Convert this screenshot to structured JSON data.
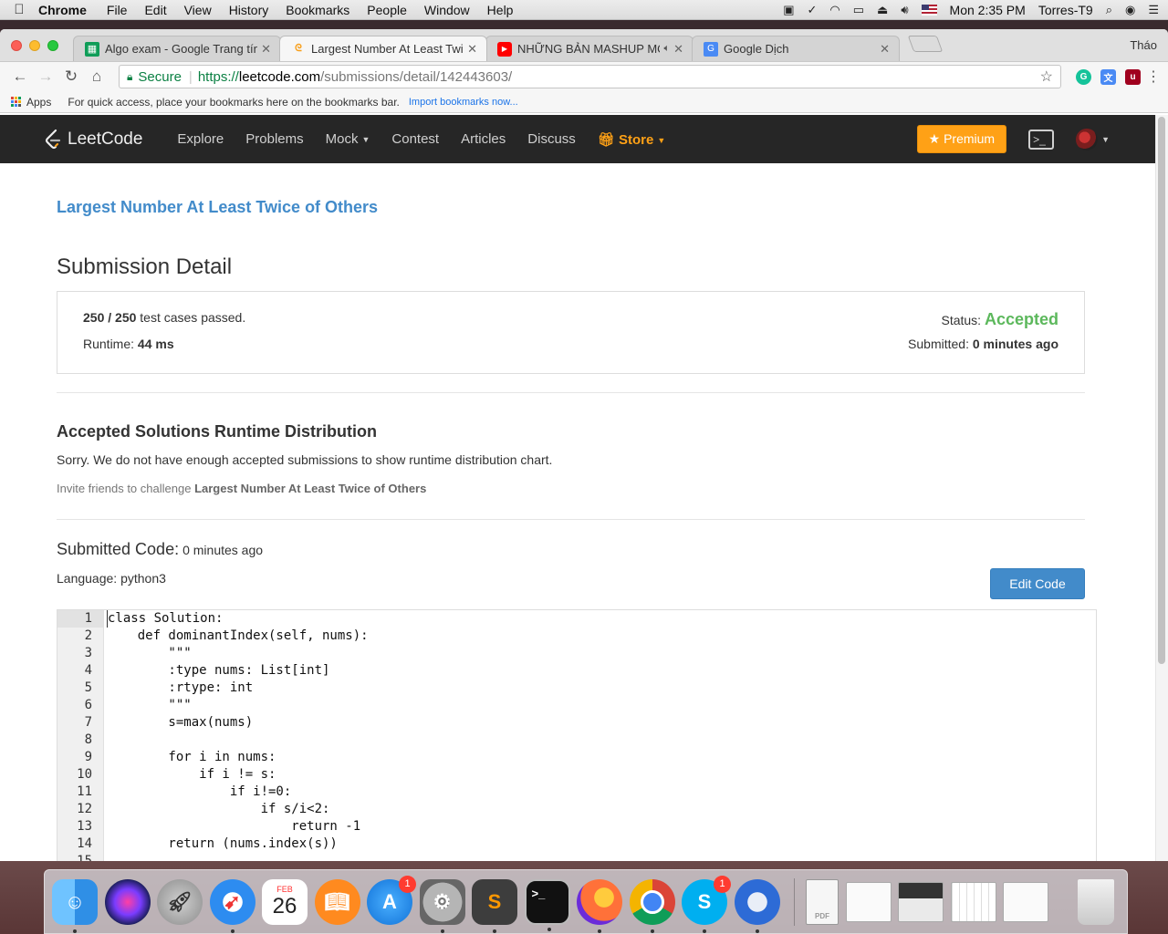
{
  "menubar": {
    "app_name": "Chrome",
    "menus": [
      "File",
      "Edit",
      "View",
      "History",
      "Bookmarks",
      "People",
      "Window",
      "Help"
    ],
    "clock": "Mon 2:35 PM",
    "username": "Torres-T9"
  },
  "browser": {
    "profile_name": "Tháo",
    "tabs": [
      {
        "title": "Algo exam - Google Trang tính",
        "icon": "sheets-icon",
        "active": false
      },
      {
        "title": "Largest Number At Least Twice",
        "icon": "leetcode-icon",
        "active": true
      },
      {
        "title": "NHỮNG BẢN MASHUP MỚI",
        "icon": "youtube-icon",
        "active": false
      },
      {
        "title": "Google Dịch",
        "icon": "google-translate-icon",
        "active": false
      }
    ],
    "omnibox": {
      "secure_label": "Secure",
      "url_scheme": "https://",
      "url_host": "leetcode.com",
      "url_path": "/submissions/detail/142443603/"
    },
    "bookmarks_bar": {
      "apps_label": "Apps",
      "hint": "For quick access, place your bookmarks here on the bookmarks bar.",
      "import_link": "Import bookmarks now..."
    }
  },
  "leetcode_nav": {
    "logo_text": "LeetCode",
    "items": [
      "Explore",
      "Problems",
      "Mock",
      "Contest",
      "Articles",
      "Discuss"
    ],
    "store_label": "Store",
    "premium_label": "Premium"
  },
  "submission": {
    "problem_title": "Largest Number At Least Twice of Others",
    "heading": "Submission Detail",
    "passed": "250 / 250",
    "passed_suffix": "test cases passed.",
    "runtime_label": "Runtime:",
    "runtime_value": "44 ms",
    "status_label": "Status:",
    "status_value": "Accepted",
    "submitted_label": "Submitted:",
    "submitted_value": "0 minutes ago"
  },
  "distribution": {
    "title": "Accepted Solutions Runtime Distribution",
    "message": "Sorry. We do not have enough accepted submissions to show runtime distribution chart.",
    "invite_prefix": "Invite friends to challenge",
    "invite_problem": "Largest Number At Least Twice of Others"
  },
  "code_section": {
    "title": "Submitted Code:",
    "time": "0 minutes ago",
    "language": "Language: python3",
    "edit_label": "Edit Code",
    "lines": [
      "class Solution:",
      "    def dominantIndex(self, nums):",
      "        \"\"\"",
      "        :type nums: List[int]",
      "        :rtype: int",
      "        \"\"\"",
      "        s=max(nums)",
      "",
      "        for i in nums:",
      "            if i != s:",
      "                if i!=0:",
      "                    if s/i<2:",
      "                        return -1",
      "        return (nums.index(s))",
      ""
    ]
  },
  "dock": {
    "calendar_month": "FEB",
    "calendar_day": "26",
    "appstore_badge": "1",
    "skype_badge": "1",
    "pdf_label": "PDF"
  },
  "colors": {
    "accepted": "#5cb85c",
    "link": "#428bca",
    "premium": "#ffa116",
    "nav_bg": "#262626"
  }
}
